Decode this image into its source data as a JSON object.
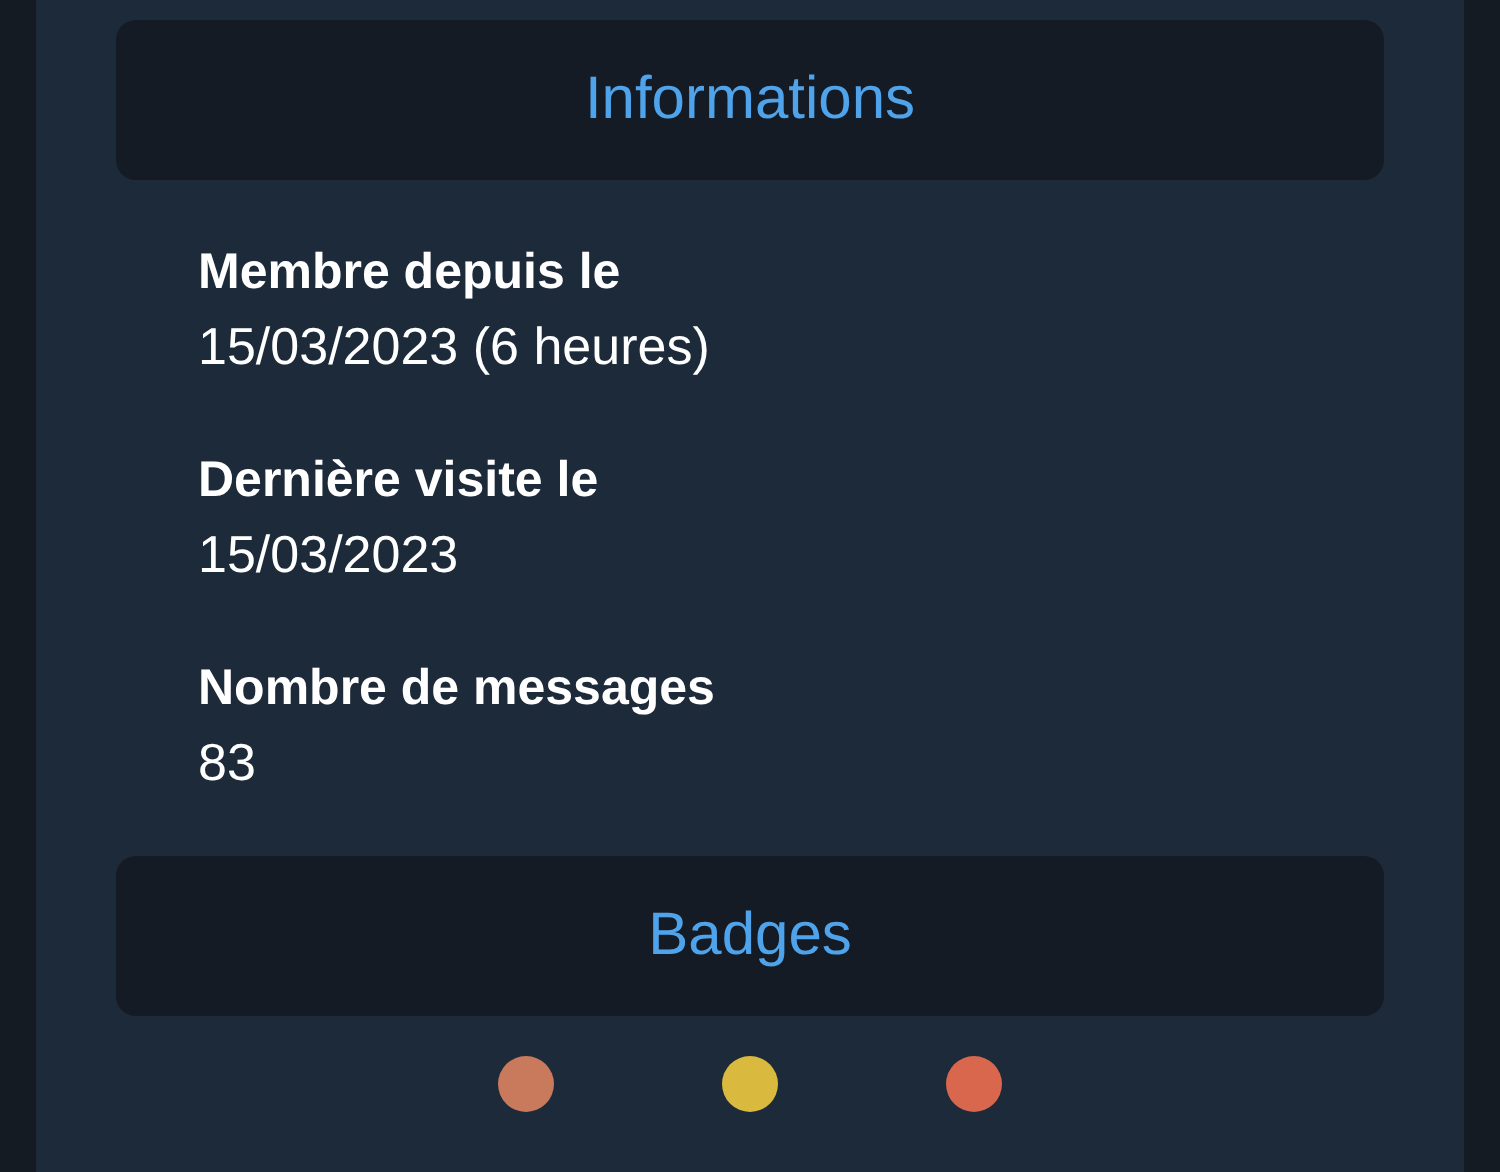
{
  "sections": [
    {
      "title": "Informations"
    },
    {
      "title": "Badges"
    }
  ],
  "info": [
    {
      "label": "Membre depuis le",
      "value": "15/03/2023 (6 heures)"
    },
    {
      "label": "Dernière visite le",
      "value": "15/03/2023"
    },
    {
      "label": "Nombre de messages",
      "value": "83"
    }
  ],
  "badges": [
    {
      "color": "#c97a5c"
    },
    {
      "color": "#d9b93e"
    },
    {
      "color": "#d8674e"
    }
  ]
}
